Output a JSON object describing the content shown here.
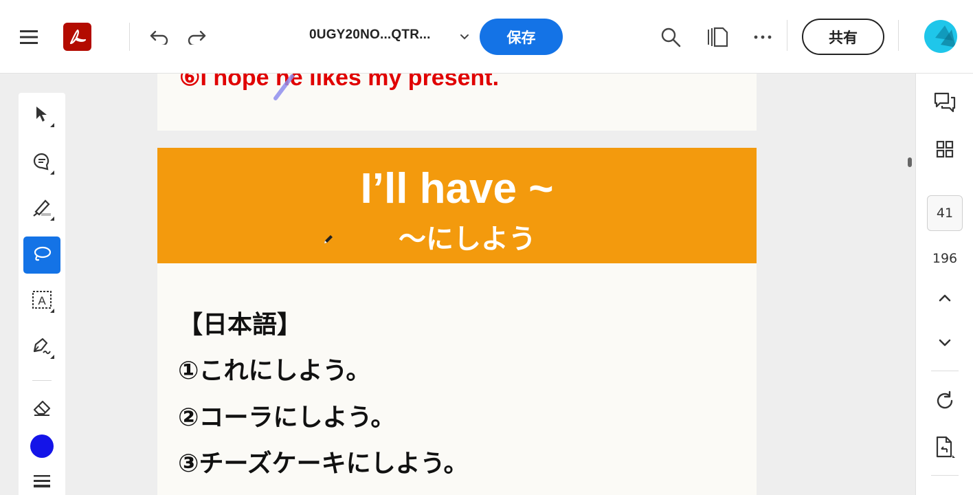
{
  "topbar": {
    "menu_icon": "hamburger-menu-icon",
    "app_logo_icon": "adobe-acrobat-logo",
    "undo_icon": "undo-icon",
    "redo_icon": "redo-icon",
    "filename": "0UGY20NO...QTR...",
    "filename_chevron_icon": "chevron-down-icon",
    "save_label": "保存",
    "search_icon": "search-icon",
    "pages_icon": "pages-icon",
    "more_icon": "more-icon",
    "share_label": "共有",
    "avatar_icon": "avatar"
  },
  "left_tools": [
    {
      "name": "select-tool",
      "icon": "cursor-arrow-icon"
    },
    {
      "name": "comment-tool",
      "icon": "comment-icon"
    },
    {
      "name": "highlight-tool",
      "icon": "highlighter-icon"
    },
    {
      "name": "lasso-draw-tool",
      "icon": "lasso-icon",
      "active": true
    },
    {
      "name": "text-box-tool",
      "icon": "text-box-icon"
    },
    {
      "name": "sign-tool",
      "icon": "pen-sign-icon"
    },
    {
      "name": "eraser-tool",
      "icon": "eraser-icon"
    },
    {
      "name": "color-picker",
      "icon": "color-dot",
      "color": "#1414e8"
    },
    {
      "name": "stroke-menu",
      "icon": "stroke-lines-icon"
    }
  ],
  "right_rail": {
    "comments_icon": "comments-icon",
    "thumbnails_icon": "grid-icon",
    "current_page": "41",
    "total_pages": "196",
    "prev_page_icon": "chevron-up-icon",
    "next_page_icon": "chevron-down-icon",
    "rotate_icon": "refresh-icon",
    "page_tools_icon": "document-icon"
  },
  "document": {
    "page1_text": "⑥I hope he likes my present.",
    "banner_title": "I’ll have ~",
    "banner_subtitle": "〜にしよう",
    "lines": [
      "【日本語】",
      "①これにしよう。",
      "②コーラにしよう。",
      "③チーズケーキにしよう。"
    ]
  },
  "colors": {
    "accent": "#1473e6",
    "banner": "#f39a0d",
    "red_text": "#e00000",
    "page_bg": "#fbfaf6"
  }
}
